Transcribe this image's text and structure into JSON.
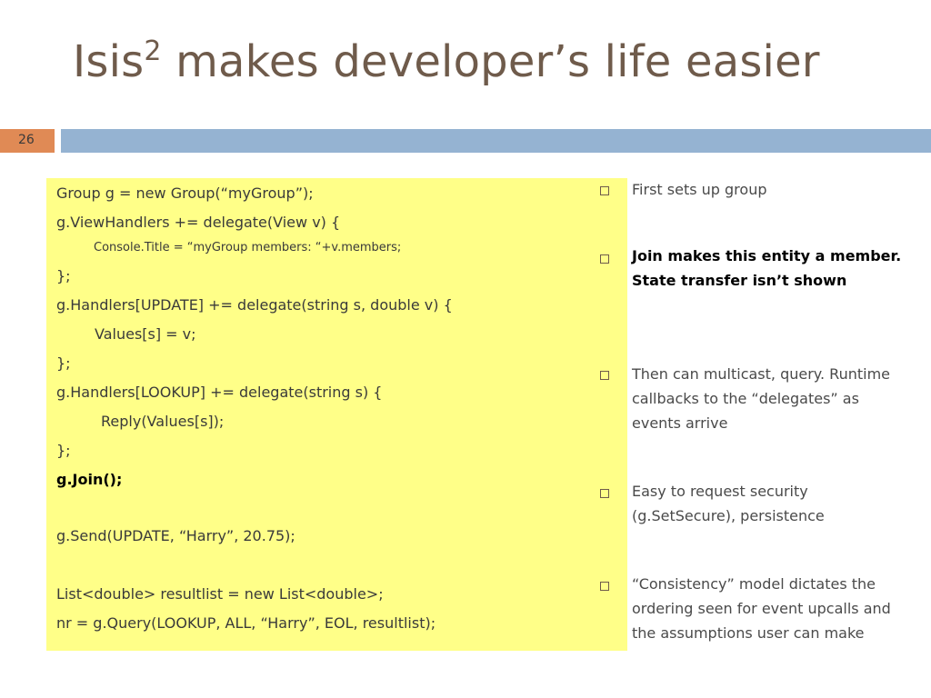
{
  "title": {
    "main": "Isis",
    "superscript": "2",
    "rest": " makes developer’s life easier"
  },
  "slide_number": "26",
  "code": [
    "Group g = new Group(“myGroup”);",
    "g.ViewHandlers += delegate(View v) {",
    "Console.Title = “myGroup members: “+v.members;",
    "};",
    "g.Handlers[UPDATE] += delegate(string s, double v) {",
    "Values[s] = v;",
    "};",
    "g.Handlers[LOOKUP] += delegate(string s) {",
    "Reply(Values[s]);",
    "};",
    "g.Join();",
    "g.Send(UPDATE, “Harry”, 20.75);",
    "List<double> resultlist = new List<double>;",
    "nr = g.Query(LOOKUP, ALL, “Harry”, EOL, resultlist);"
  ],
  "bullets": [
    "First sets up group",
    "Join makes this entity a member.  State transfer isn’t shown",
    "Then can multicast, query. Runtime callbacks to the “delegates” as events arrive",
    "Easy to request security (g.SetSecure), persistence",
    "“Consistency” model dictates the ordering seen for event upcalls and the assumptions user can make"
  ]
}
